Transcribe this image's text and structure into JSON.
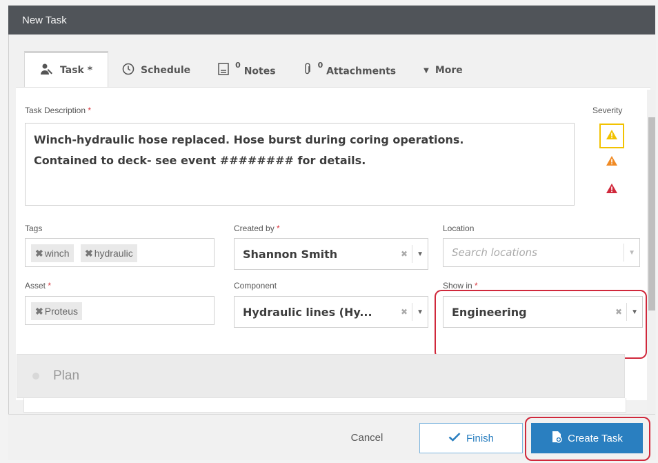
{
  "window": {
    "title": "New Task"
  },
  "tabs": [
    {
      "label": "Task *",
      "icon": "user-wrench-icon"
    },
    {
      "label": "Schedule",
      "icon": "clock-icon"
    },
    {
      "count": "0",
      "label": "Notes",
      "icon": "note-icon"
    },
    {
      "count": "0",
      "label": "Attachments",
      "icon": "paperclip-icon"
    },
    {
      "label": "More",
      "icon": "caret-down-icon"
    }
  ],
  "description": {
    "label": "Task Description",
    "required": "*",
    "line1": "Winch-hydraulic hose replaced.  Hose burst during coring operations.",
    "line2": "Contained to deck- see event ######## for details."
  },
  "severity": {
    "label": "Severity",
    "levels": [
      {
        "name": "low",
        "color": "#f2c200",
        "selected": true
      },
      {
        "name": "medium",
        "color": "#f08a24",
        "selected": false
      },
      {
        "name": "high",
        "color": "#d0283b",
        "selected": false
      }
    ]
  },
  "tags": {
    "label": "Tags",
    "items": [
      "winch",
      "hydraulic"
    ]
  },
  "created_by": {
    "label": "Created by",
    "required": "*",
    "value": "Shannon Smith"
  },
  "location": {
    "label": "Location",
    "placeholder": "Search locations"
  },
  "asset": {
    "label": "Asset",
    "required": "*",
    "items": [
      "Proteus"
    ]
  },
  "component": {
    "label": "Component",
    "value": "Hydraulic lines (Hy..."
  },
  "show_in": {
    "label": "Show in",
    "required": "*",
    "value": "Engineering"
  },
  "plan": {
    "label": "Plan"
  },
  "footer": {
    "cancel": "Cancel",
    "finish": "Finish",
    "create": "Create Task"
  },
  "colors": {
    "accent": "#2a7fc0",
    "highlight": "#d0283b",
    "titlebar": "#505459"
  }
}
